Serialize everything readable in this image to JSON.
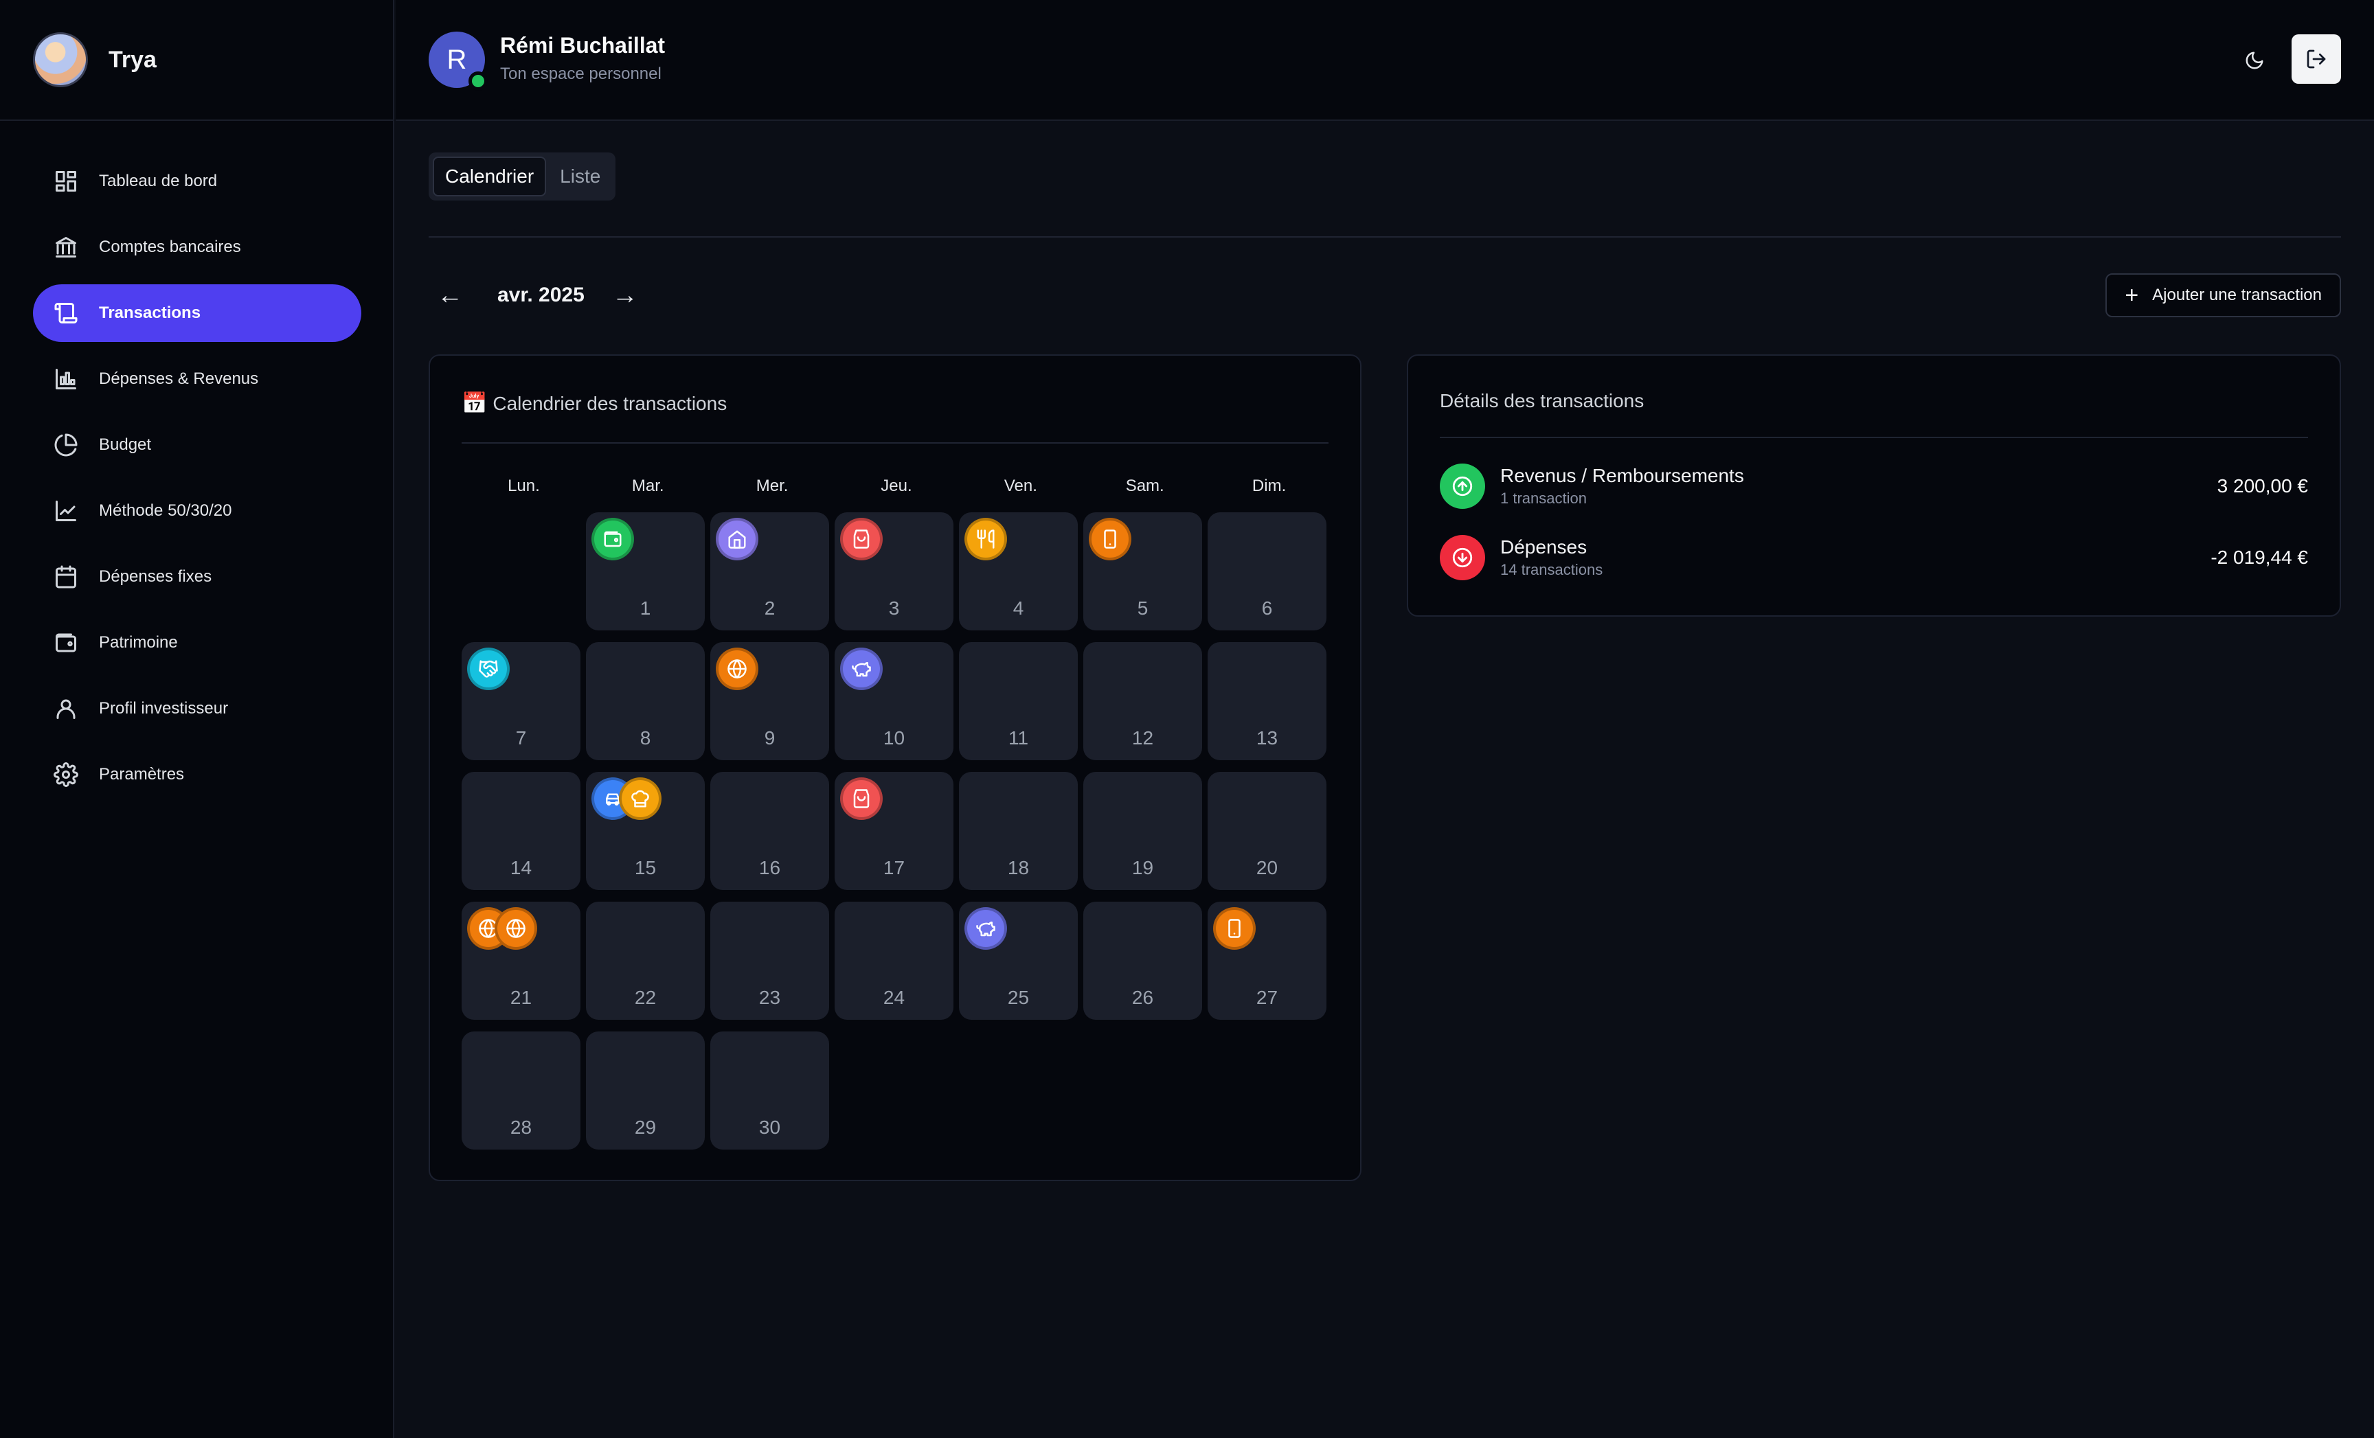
{
  "brand": {
    "name": "Trya"
  },
  "user": {
    "initial": "R",
    "name": "Rémi Buchaillat",
    "subtitle": "Ton espace personnel"
  },
  "sidebar": {
    "items": [
      {
        "label": "Tableau de bord",
        "icon": "dashboard-icon",
        "active": false
      },
      {
        "label": "Comptes bancaires",
        "icon": "bank-icon",
        "active": false
      },
      {
        "label": "Transactions",
        "icon": "scroll-icon",
        "active": true
      },
      {
        "label": "Dépenses & Revenus",
        "icon": "bar-chart-icon",
        "active": false
      },
      {
        "label": "Budget",
        "icon": "pie-chart-icon",
        "active": false
      },
      {
        "label": "Méthode 50/30/20",
        "icon": "line-chart-icon",
        "active": false
      },
      {
        "label": "Dépenses fixes",
        "icon": "calendar-icon",
        "active": false
      },
      {
        "label": "Patrimoine",
        "icon": "wallet-icon",
        "active": false
      },
      {
        "label": "Profil investisseur",
        "icon": "user-icon",
        "active": false
      },
      {
        "label": "Paramètres",
        "icon": "gear-icon",
        "active": false
      }
    ]
  },
  "tabs": {
    "calendar": "Calendrier",
    "list": "Liste"
  },
  "month": {
    "label": "avr. 2025",
    "prev": "←",
    "next": "→"
  },
  "add_button": {
    "label": "Ajouter une transaction"
  },
  "calendar": {
    "title": "Calendrier des transactions",
    "title_icon": "📅",
    "weekdays": [
      "Lun.",
      "Mar.",
      "Mer.",
      "Jeu.",
      "Ven.",
      "Sam.",
      "Dim."
    ],
    "leading_empty": 1,
    "days": [
      {
        "day": "1",
        "icons": [
          {
            "name": "wallet-icon",
            "color": "#22c55e"
          }
        ]
      },
      {
        "day": "2",
        "icons": [
          {
            "name": "home-icon",
            "color": "#8b7cf0"
          }
        ]
      },
      {
        "day": "3",
        "icons": [
          {
            "name": "shopping-bag-icon",
            "color": "#f05252"
          }
        ]
      },
      {
        "day": "4",
        "icons": [
          {
            "name": "utensils-icon",
            "color": "#f5a30b"
          }
        ]
      },
      {
        "day": "5",
        "icons": [
          {
            "name": "smartphone-icon",
            "color": "#f07c0b"
          }
        ]
      },
      {
        "day": "6",
        "icons": []
      },
      {
        "day": "7",
        "icons": [
          {
            "name": "handshake-icon",
            "color": "#16c2e0"
          }
        ]
      },
      {
        "day": "8",
        "icons": []
      },
      {
        "day": "9",
        "icons": [
          {
            "name": "globe-icon",
            "color": "#f07c0b"
          }
        ]
      },
      {
        "day": "10",
        "icons": [
          {
            "name": "piggy-bank-icon",
            "color": "#6f74ee"
          }
        ]
      },
      {
        "day": "11",
        "icons": []
      },
      {
        "day": "12",
        "icons": []
      },
      {
        "day": "13",
        "icons": []
      },
      {
        "day": "14",
        "icons": []
      },
      {
        "day": "15",
        "icons": [
          {
            "name": "car-icon",
            "color": "#3b82f6"
          },
          {
            "name": "chef-hat-icon",
            "color": "#f5a30b"
          }
        ]
      },
      {
        "day": "16",
        "icons": []
      },
      {
        "day": "17",
        "icons": [
          {
            "name": "shopping-bag-icon",
            "color": "#f05252"
          }
        ]
      },
      {
        "day": "18",
        "icons": []
      },
      {
        "day": "19",
        "icons": []
      },
      {
        "day": "20",
        "icons": []
      },
      {
        "day": "21",
        "icons": [
          {
            "name": "globe-icon",
            "color": "#f07c0b"
          },
          {
            "name": "globe-icon",
            "color": "#f07c0b"
          }
        ]
      },
      {
        "day": "22",
        "icons": []
      },
      {
        "day": "23",
        "icons": []
      },
      {
        "day": "24",
        "icons": []
      },
      {
        "day": "25",
        "icons": [
          {
            "name": "piggy-bank-icon",
            "color": "#6f74ee"
          }
        ]
      },
      {
        "day": "26",
        "icons": []
      },
      {
        "day": "27",
        "icons": [
          {
            "name": "smartphone-icon",
            "color": "#f07c0b"
          }
        ]
      },
      {
        "day": "28",
        "icons": []
      },
      {
        "day": "29",
        "icons": []
      },
      {
        "day": "30",
        "icons": []
      }
    ]
  },
  "details": {
    "title": "Détails des transactions",
    "income": {
      "label": "Revenus / Remboursements",
      "count": "1 transaction",
      "amount": "3 200,00 €",
      "color": "#22c55e",
      "icon": "arrow-up-circle-icon"
    },
    "expenses": {
      "label": "Dépenses",
      "count": "14 transactions",
      "amount": "-2 019,44 €",
      "color": "#ef2b3d",
      "icon": "arrow-down-circle-icon"
    }
  }
}
